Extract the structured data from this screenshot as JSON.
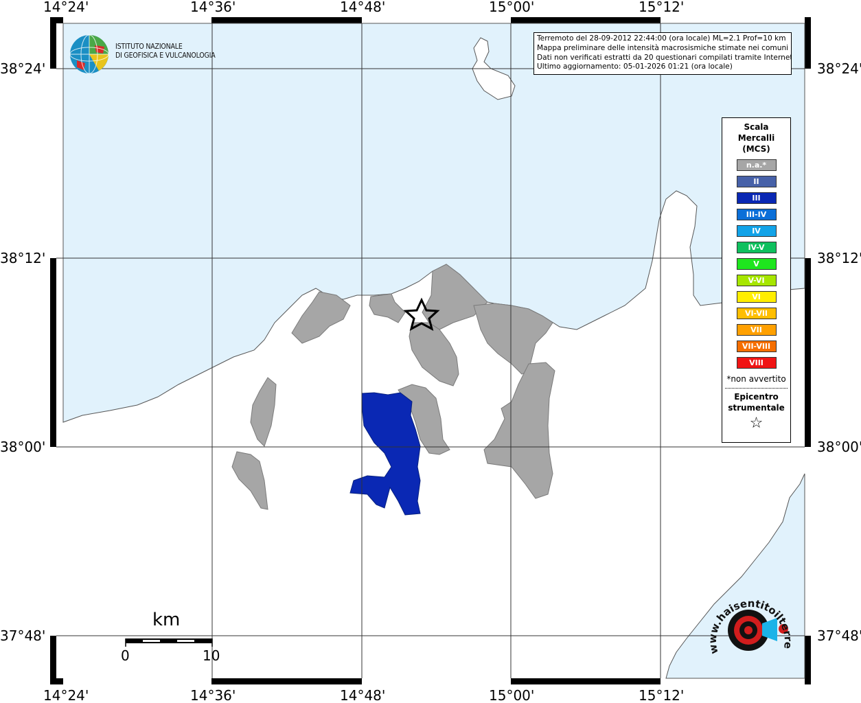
{
  "map": {
    "title_lines": [
      "Terremoto del 28-09-2012 22:44:00 (ora locale) ML=2.1 Prof=10 km",
      "Mappa preliminare delle intensità macrosismiche stimate nei comuni",
      "Dati non verificati estratti da 20 questionari compilati tramite Internet.",
      "Ultimo aggiornamento: 05-01-2026 01:21 (ora locale)"
    ],
    "lon_labels": [
      "14°24'",
      "14°36'",
      "14°48'",
      "15°00'",
      "15°12'"
    ],
    "lat_labels": [
      "38°24'",
      "38°12'",
      "38°00'",
      "37°48'"
    ],
    "colors": {
      "sea": "#e1f2fc",
      "land": "#ffffff",
      "coast": "#555555",
      "na": "#a6a6a6",
      "intensity_III": "#0a28b4"
    }
  },
  "logo": {
    "line1": "ISTITUTO NAZIONALE",
    "line2": "DI GEOFISICA E VULCANOLOGIA",
    "icon": "ingv-globe-icon"
  },
  "legend": {
    "title": [
      "Scala",
      "Mercalli",
      "(MCS)"
    ],
    "items": [
      {
        "label": "n.a.*",
        "color": "#a6a6a6"
      },
      {
        "label": "II",
        "color": "#4761a8"
      },
      {
        "label": "III",
        "color": "#0a28b4"
      },
      {
        "label": "III-IV",
        "color": "#0b6fd8"
      },
      {
        "label": "IV",
        "color": "#12a3e8"
      },
      {
        "label": "IV-V",
        "color": "#0fc05e"
      },
      {
        "label": "V",
        "color": "#1ee61e"
      },
      {
        "label": "V-VI",
        "color": "#a6e600"
      },
      {
        "label": "VI",
        "color": "#ffee00"
      },
      {
        "label": "VI-VII",
        "color": "#ffbe00"
      },
      {
        "label": "VII",
        "color": "#ffa000"
      },
      {
        "label": "VII-VIII",
        "color": "#f56e00"
      },
      {
        "label": "VIII",
        "color": "#f01414"
      }
    ],
    "note": "*non avvertito",
    "epicenter": [
      "Epicentro",
      "strumentale"
    ],
    "epicenter_icon": "star-icon"
  },
  "scale": {
    "unit": "km",
    "min": "0",
    "max": "10"
  },
  "watermark": {
    "text": "www.haisentitoilterremoto.it",
    "icon": "haisentito-logo-icon"
  }
}
